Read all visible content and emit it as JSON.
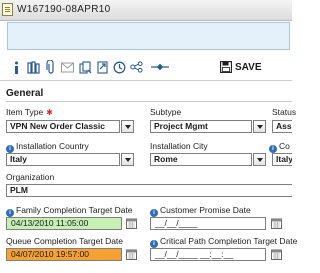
{
  "window": {
    "title": "W167190-08APR10"
  },
  "toolbar": {
    "icons": [
      "info-icon",
      "library-icon",
      "attachment-icon",
      "mail-icon",
      "copy-icon",
      "link-icon",
      "clock-icon",
      "hierarchy-icon",
      "dependency-icon"
    ],
    "save_label": "SAVE"
  },
  "section": {
    "title": "General"
  },
  "fields": {
    "item_type": {
      "label": "Item Type",
      "required_mark": "✱",
      "value": "VPN New Order Classic"
    },
    "subtype": {
      "label": "Subtype",
      "value": "Project Mgmt"
    },
    "status": {
      "label": "Status",
      "value": "Assi"
    },
    "installation_country": {
      "label": "Installation Country",
      "value": "Italy"
    },
    "installation_city": {
      "label": "Installation City",
      "value": "Rome"
    },
    "third_col": {
      "label": "Co",
      "value": "Italy"
    },
    "organization": {
      "label": "Organization",
      "value": "PLM"
    },
    "family_completion": {
      "label": "Family Completion Target Date",
      "value": "04/13/2010 11:05:00"
    },
    "customer_promise": {
      "label": "Customer Promise Date",
      "value": "__/__/____"
    },
    "queue_completion": {
      "label": "Queue Completion Target Date",
      "value": "04/07/2010 19:57:00"
    },
    "critical_path": {
      "label": "Critical Path Completion Target Date",
      "value": "__/__/____ __:__:__"
    }
  },
  "colors": {
    "family_completion_bg": "#c6f0b4",
    "queue_completion_bg": "#f5a233",
    "info_icon": "#2f6fb3",
    "required": "#d0262e"
  }
}
